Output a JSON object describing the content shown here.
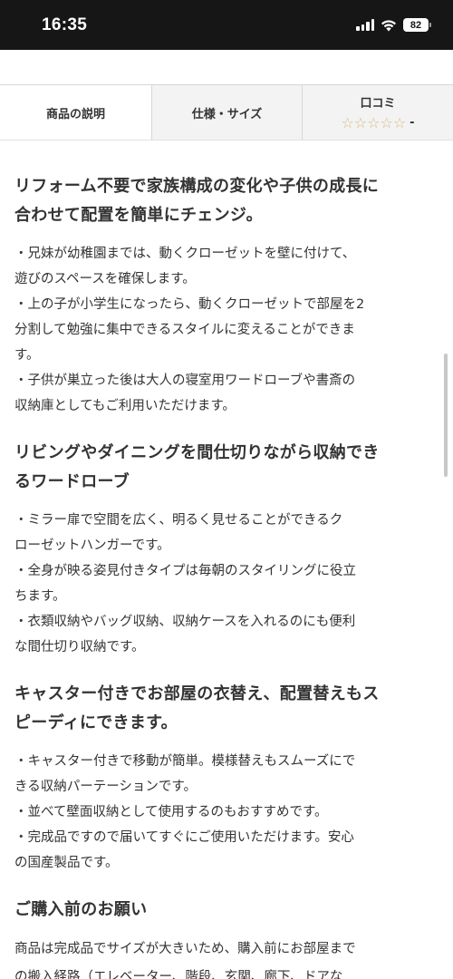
{
  "status_bar": {
    "time": "16:35",
    "battery": "82",
    "icons": [
      "signal-icon",
      "wifi-icon",
      "battery-icon"
    ]
  },
  "tabs": [
    {
      "label": "商品の説明",
      "active": true
    },
    {
      "label": "仕様・サイズ",
      "active": false
    },
    {
      "label": "口コミ",
      "active": false,
      "stars": "☆☆☆☆☆",
      "rating": "-"
    }
  ],
  "sections": [
    {
      "heading_lines": [
        "リフォーム不要で家族構成の変化や子供の成長に",
        "合わせて配置を簡単にチェンジ。"
      ],
      "body_lines": [
        "・兄妹が幼稚園までは、動くクローゼットを壁に付けて、",
        "遊びのスペースを確保します。",
        "・上の子が小学生になったら、動くクローゼットで部屋を2",
        "分割して勉強に集中できるスタイルに変えることができま",
        "す。",
        "・子供が巣立った後は大人の寝室用ワードローブや書斎の",
        "収納庫としてもご利用いただけます。"
      ]
    },
    {
      "heading_lines": [
        "リビングやダイニングを間仕切りながら収納でき",
        "るワードローブ"
      ],
      "body_lines": [
        "・ミラー扉で空間を広く、明るく見せることができるク",
        "ローゼットハンガーです。",
        "・全身が映る姿見付きタイプは毎朝のスタイリングに役立",
        "ちます。",
        "・衣類収納やバッグ収納、収納ケースを入れるのにも便利",
        "な間仕切り収納です。"
      ]
    },
    {
      "heading_lines": [
        "キャスター付きでお部屋の衣替え、配置替えもス",
        "ピーディにできます。"
      ],
      "body_lines": [
        "・キャスター付きで移動が簡単。模様替えもスムーズにで",
        "きる収納パーテーションです。",
        "・並べて壁面収納として使用するのもおすすめです。",
        "・完成品ですので届いてすぐにご使用いただけます。安心",
        "の国産製品です。"
      ]
    },
    {
      "heading_lines": [
        "ご購入前のお願い"
      ],
      "body_lines": [
        "商品は完成品でサイズが大きいため、購入前にお部屋まで",
        "の搬入経路（エレベーター、階段、玄関、廊下、ドアな"
      ]
    }
  ]
}
